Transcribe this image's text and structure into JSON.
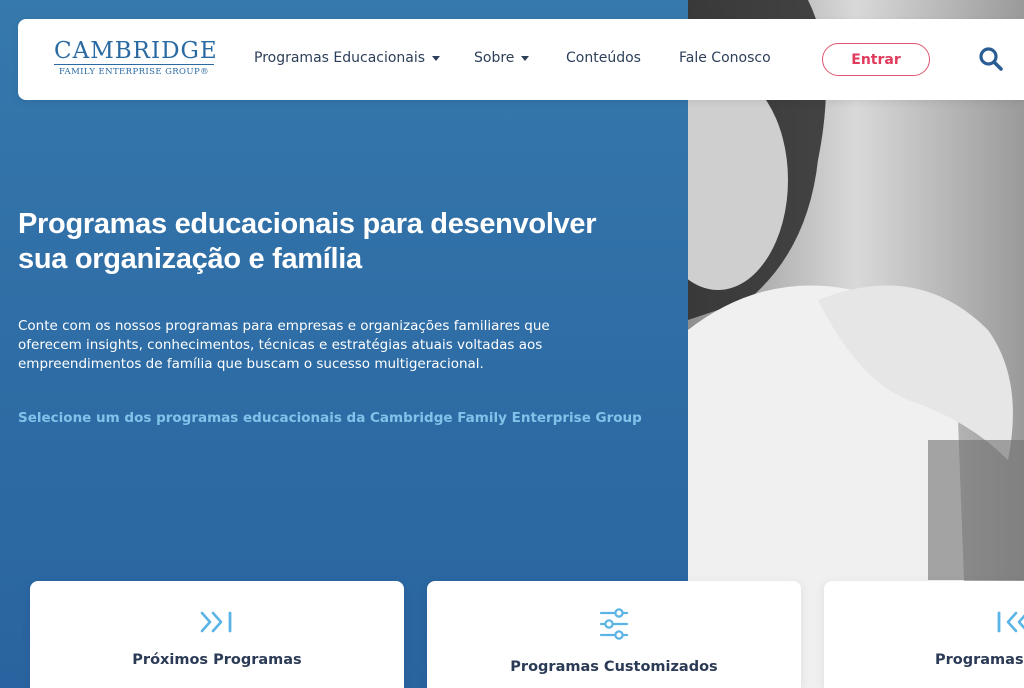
{
  "logo": {
    "main": "CAMBRIDGE",
    "sub": "FAMILY ENTERPRISE GROUP®"
  },
  "nav": {
    "items": [
      {
        "label": "Programas Educacionais"
      },
      {
        "label": "Sobre"
      },
      {
        "label": "Conteúdos"
      },
      {
        "label": "Fale Conosco"
      }
    ],
    "login_label": "Entrar"
  },
  "hero": {
    "title_line1": "Programas educacionais para desenvolver",
    "title_line2": "sua organização e família",
    "description_line1": "Conte com os nossos programas para empresas e organizações familiares que",
    "description_line2": "oferecem insights, conhecimentos, técnicas e estratégias atuais voltadas aos",
    "description_line3": "empreendimentos de família que buscam o sucesso multigeracional.",
    "link": "Selecione um dos programas educacionais da Cambridge Family Enterprise Group"
  },
  "cards": [
    {
      "label": "Próximos Programas",
      "icon": "skip-forward-icon"
    },
    {
      "label": "Programas Customizados",
      "icon": "sliders-icon"
    },
    {
      "label": "Programas A",
      "icon": "skip-back-icon"
    }
  ],
  "colors": {
    "brand_blue": "#2a6aa2",
    "hero_blue": "#2f6ea6",
    "accent_pink": "#e03a5c",
    "link_cyan": "#7fc3ea",
    "icon_cyan": "#5ab4e5"
  }
}
